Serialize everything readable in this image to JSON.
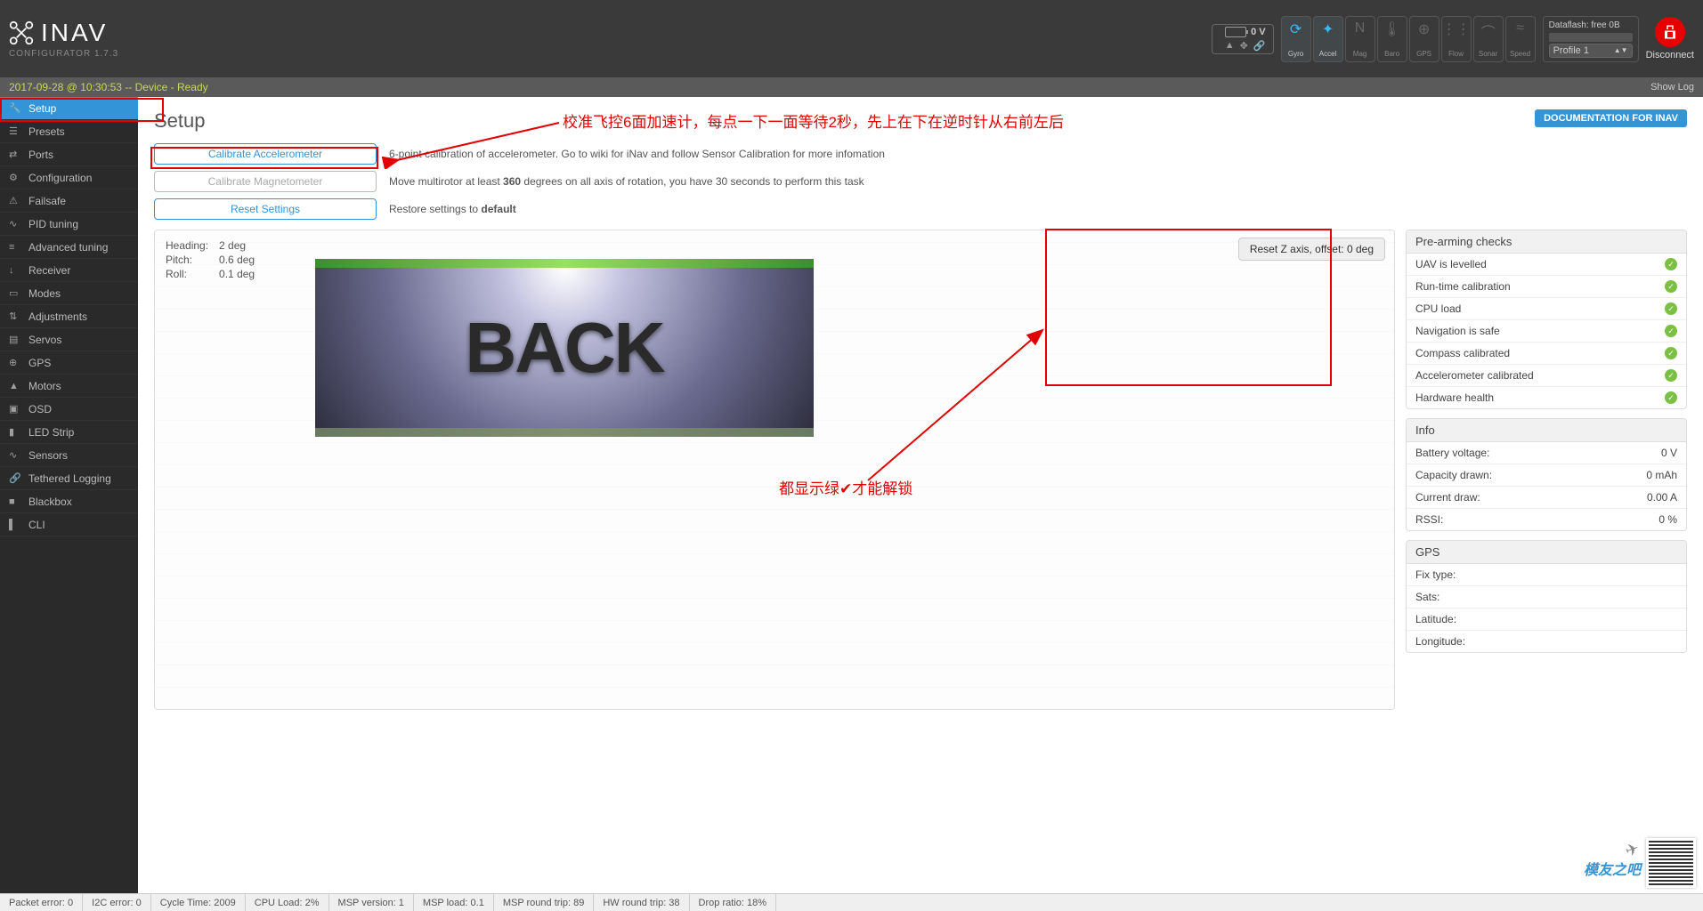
{
  "app": {
    "name": "INAV",
    "configurator": "CONFIGURATOR  1.7.3"
  },
  "header": {
    "battery_voltage": "0 V",
    "dataflash": "Dataflash: free 0B",
    "profile": "Profile 1",
    "disconnect": "Disconnect",
    "sensors": [
      {
        "label": "Gyro",
        "active": true,
        "glyph": "⟳"
      },
      {
        "label": "Accel",
        "active": true,
        "glyph": "✦"
      },
      {
        "label": "Mag",
        "active": false,
        "glyph": "N"
      },
      {
        "label": "Baro",
        "active": false,
        "glyph": "🌡"
      },
      {
        "label": "GPS",
        "active": false,
        "glyph": "⊕"
      },
      {
        "label": "Flow",
        "active": false,
        "glyph": "⋮⋮"
      },
      {
        "label": "Sonar",
        "active": false,
        "glyph": "⌒"
      },
      {
        "label": "Speed",
        "active": false,
        "glyph": "≈"
      }
    ]
  },
  "status": {
    "line": "2017-09-28 @ 10:30:53 -- Device - Ready",
    "showlog": "Show Log"
  },
  "sidebar": {
    "items": [
      {
        "label": "Setup",
        "icon": "🔧",
        "active": true
      },
      {
        "label": "Presets",
        "icon": "☰",
        "active": false
      },
      {
        "label": "Ports",
        "icon": "⇄",
        "active": false
      },
      {
        "label": "Configuration",
        "icon": "⚙",
        "active": false
      },
      {
        "label": "Failsafe",
        "icon": "⚠",
        "active": false
      },
      {
        "label": "PID tuning",
        "icon": "∿",
        "active": false
      },
      {
        "label": "Advanced tuning",
        "icon": "≡",
        "active": false
      },
      {
        "label": "Receiver",
        "icon": "↓",
        "active": false
      },
      {
        "label": "Modes",
        "icon": "▭",
        "active": false
      },
      {
        "label": "Adjustments",
        "icon": "⇅",
        "active": false
      },
      {
        "label": "Servos",
        "icon": "▤",
        "active": false
      },
      {
        "label": "GPS",
        "icon": "⊕",
        "active": false
      },
      {
        "label": "Motors",
        "icon": "▲",
        "active": false
      },
      {
        "label": "OSD",
        "icon": "▣",
        "active": false
      },
      {
        "label": "LED Strip",
        "icon": "▮",
        "active": false
      },
      {
        "label": "Sensors",
        "icon": "∿",
        "active": false
      },
      {
        "label": "Tethered Logging",
        "icon": "🔗",
        "active": false
      },
      {
        "label": "Blackbox",
        "icon": "■",
        "active": false
      },
      {
        "label": "CLI",
        "icon": "▌",
        "active": false
      }
    ]
  },
  "setup": {
    "title": "Setup",
    "doc_link": "DOCUMENTATION FOR INAV",
    "calib_accel_btn": "Calibrate Accelerometer",
    "calib_accel_desc": "6-point calibration of accelerometer. Go to wiki for iNav and follow Sensor Calibration for more infomation",
    "calib_mag_btn": "Calibrate Magnetometer",
    "calib_mag_desc_pre": "Move multirotor at least ",
    "calib_mag_desc_bold": "360",
    "calib_mag_desc_post": " degrees on all axis of rotation, you have 30 seconds to perform this task",
    "reset_btn": "Reset Settings",
    "reset_desc_pre": "Restore settings to ",
    "reset_desc_bold": "default",
    "reset_z": "Reset Z axis, offset: 0 deg",
    "attitude": {
      "heading_label": "Heading:",
      "heading": "2 deg",
      "pitch_label": "Pitch:",
      "pitch": "0.6 deg",
      "roll_label": "Roll:",
      "roll": "0.1 deg"
    },
    "model_text": "BACK"
  },
  "prearm": {
    "title": "Pre-arming checks",
    "items": [
      "UAV is levelled",
      "Run-time calibration",
      "CPU load",
      "Navigation is safe",
      "Compass calibrated",
      "Accelerometer calibrated",
      "Hardware health"
    ]
  },
  "info": {
    "title": "Info",
    "rows": [
      {
        "k": "Battery voltage:",
        "v": "0 V"
      },
      {
        "k": "Capacity drawn:",
        "v": "0 mAh"
      },
      {
        "k": "Current draw:",
        "v": "0.00 A"
      },
      {
        "k": "RSSI:",
        "v": "0 %"
      }
    ]
  },
  "gps": {
    "title": "GPS",
    "rows": [
      {
        "k": "Fix type:",
        "v": ""
      },
      {
        "k": "Sats:",
        "v": ""
      },
      {
        "k": "Latitude:",
        "v": ""
      },
      {
        "k": "Longitude:",
        "v": ""
      }
    ]
  },
  "annotations": {
    "top": "校准飞控6面加速计，每点一下一面等待2秒，先上在下在逆时针从右前左后",
    "right": "都显示绿✔才能解锁"
  },
  "footer": {
    "cells": [
      "Packet error: 0",
      "I2C error: 0",
      "Cycle Time: 2009",
      "CPU Load: 2%",
      "MSP version: 1",
      "MSP load: 0.1",
      "MSP round trip: 89",
      "HW round trip: 38",
      "Drop ratio: 18%"
    ]
  },
  "forum": {
    "name": "模友之吧"
  }
}
